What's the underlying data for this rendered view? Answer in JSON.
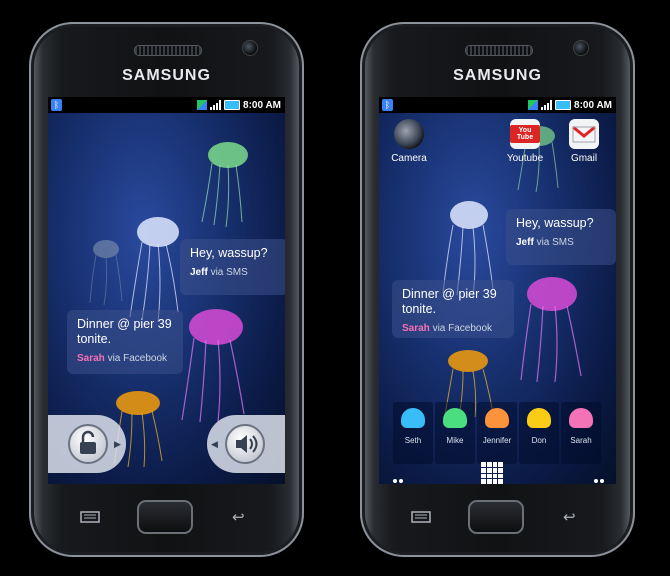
{
  "phones": [
    {
      "brand": "SAMSUNG",
      "status": {
        "time": "8:00 AM",
        "bluetooth": "ᛒ"
      },
      "messages": [
        {
          "text": "Hey, wassup?",
          "sender": "Jeff",
          "via": "via SMS"
        },
        {
          "text": "Dinner @ pier 39 tonite.",
          "sender": "Sarah",
          "via": "via Facebook"
        }
      ],
      "lock": {
        "unlock_icon": "unlock-icon",
        "sound_icon": "speaker-icon"
      }
    },
    {
      "brand": "SAMSUNG",
      "status": {
        "time": "8:00 AM",
        "bluetooth": "ᛒ"
      },
      "apps": [
        {
          "label": "Camera",
          "icon": "camera-icon"
        },
        {
          "label": "Youtube",
          "icon": "youtube-icon",
          "text": "You Tube"
        },
        {
          "label": "Gmail",
          "icon": "gmail-icon"
        }
      ],
      "messages": [
        {
          "text": "Hey, wassup?",
          "sender": "Jeff",
          "via": "via SMS"
        },
        {
          "text": "Dinner @ pier 39 tonite.",
          "sender": "Sarah",
          "via": "via Facebook"
        }
      ],
      "contacts": [
        {
          "name": "Seth",
          "color": "#38bdf8"
        },
        {
          "name": "Mike",
          "color": "#4ade80"
        },
        {
          "name": "Jennifer",
          "color": "#fb923c"
        },
        {
          "name": "Don",
          "color": "#facc15"
        },
        {
          "name": "Sarah",
          "color": "#f472b6"
        }
      ]
    }
  ],
  "colors": {
    "sender": "#f472b6",
    "screen_bg": "#17306f"
  }
}
